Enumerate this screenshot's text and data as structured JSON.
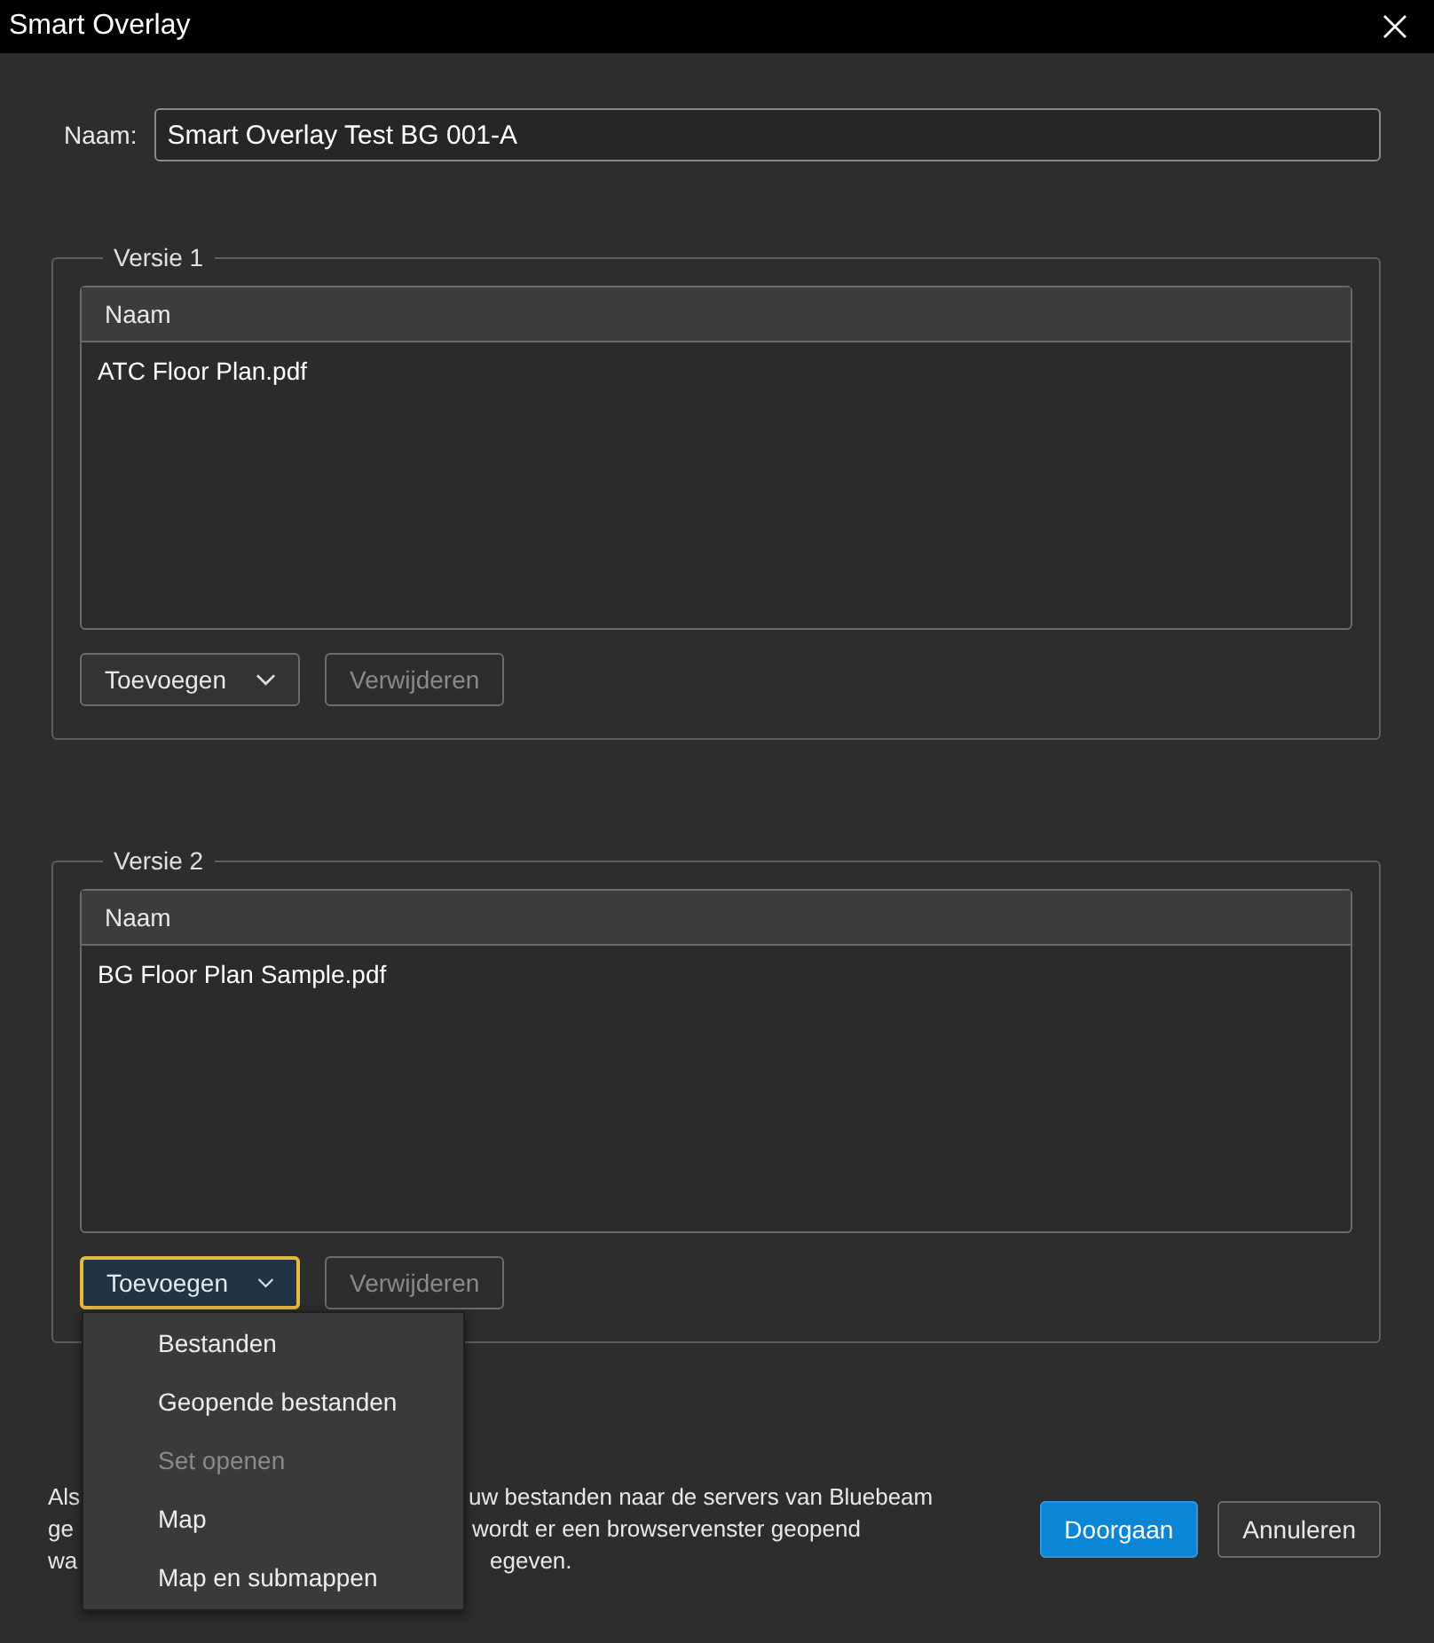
{
  "window": {
    "title": "Smart Overlay"
  },
  "name_field": {
    "label": "Naam:",
    "value": "Smart Overlay Test BG 001-A"
  },
  "versions": [
    {
      "title": "Versie 1",
      "column": "Naam",
      "files": [
        "ATC Floor Plan.pdf"
      ],
      "add_button": {
        "label": "Toevoegen",
        "focused": false
      },
      "remove_button": {
        "label": "Verwijderen",
        "disabled": true
      }
    },
    {
      "title": "Versie 2",
      "column": "Naam",
      "files": [
        "BG Floor Plan Sample.pdf"
      ],
      "add_button": {
        "label": "Toevoegen",
        "focused": true
      },
      "remove_button": {
        "label": "Verwijderen",
        "disabled": true
      },
      "menu": [
        {
          "label": "Bestanden",
          "disabled": false
        },
        {
          "label": "Geopende bestanden",
          "disabled": false
        },
        {
          "label": "Set openen",
          "disabled": true
        },
        {
          "label": "Map",
          "disabled": false
        },
        {
          "label": "Map en submappen",
          "disabled": false
        }
      ]
    }
  ],
  "notice_lines": [
    {
      "start": "Als",
      "end": "uw bestanden naar de servers van Bluebeam"
    },
    {
      "start": "ge",
      "end": "wordt er een browservenster geopend"
    },
    {
      "start": "wa",
      "end": "egeven."
    }
  ],
  "buttons": [
    {
      "label": "Doorgaan",
      "kind": "primary"
    },
    {
      "label": "Annuleren",
      "kind": "secondary"
    }
  ]
}
